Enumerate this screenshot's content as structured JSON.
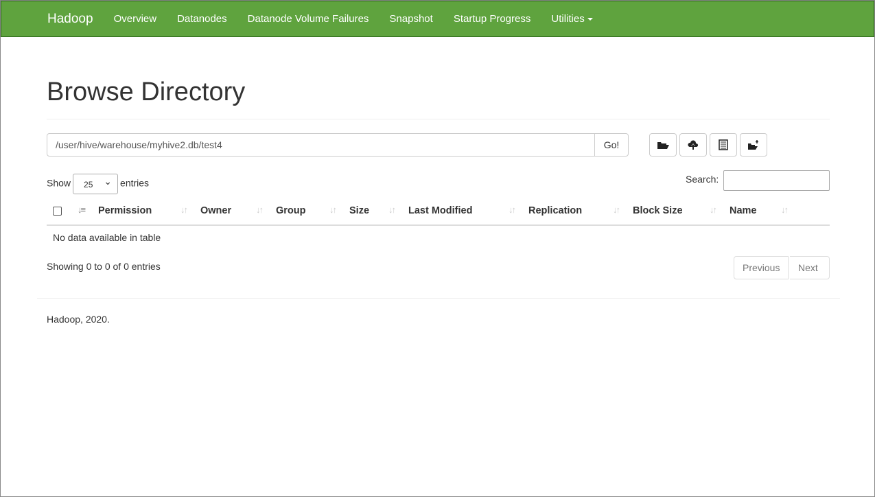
{
  "navbar": {
    "brand": "Hadoop",
    "items": [
      "Overview",
      "Datanodes",
      "Datanode Volume Failures",
      "Snapshot",
      "Startup Progress",
      "Utilities"
    ],
    "color": "#5fa33e"
  },
  "page": {
    "title": "Browse Directory"
  },
  "path_input": {
    "value": "/user/hive/warehouse/myhive2.db/test4",
    "go_label": "Go!"
  },
  "toolbar": {
    "icons": [
      "folder-open-icon",
      "cloud-upload-icon",
      "list-alt-icon",
      "new-folder-icon"
    ]
  },
  "table": {
    "show_label": "Show",
    "entries_label": "entries",
    "page_length": "25",
    "search_label": "Search:",
    "columns": [
      "Permission",
      "Owner",
      "Group",
      "Size",
      "Last Modified",
      "Replication",
      "Block Size",
      "Name"
    ],
    "empty": "No data available in table",
    "info": "Showing 0 to 0 of 0 entries",
    "previous": "Previous",
    "next": "Next"
  },
  "footer": {
    "text": "Hadoop, 2020."
  }
}
